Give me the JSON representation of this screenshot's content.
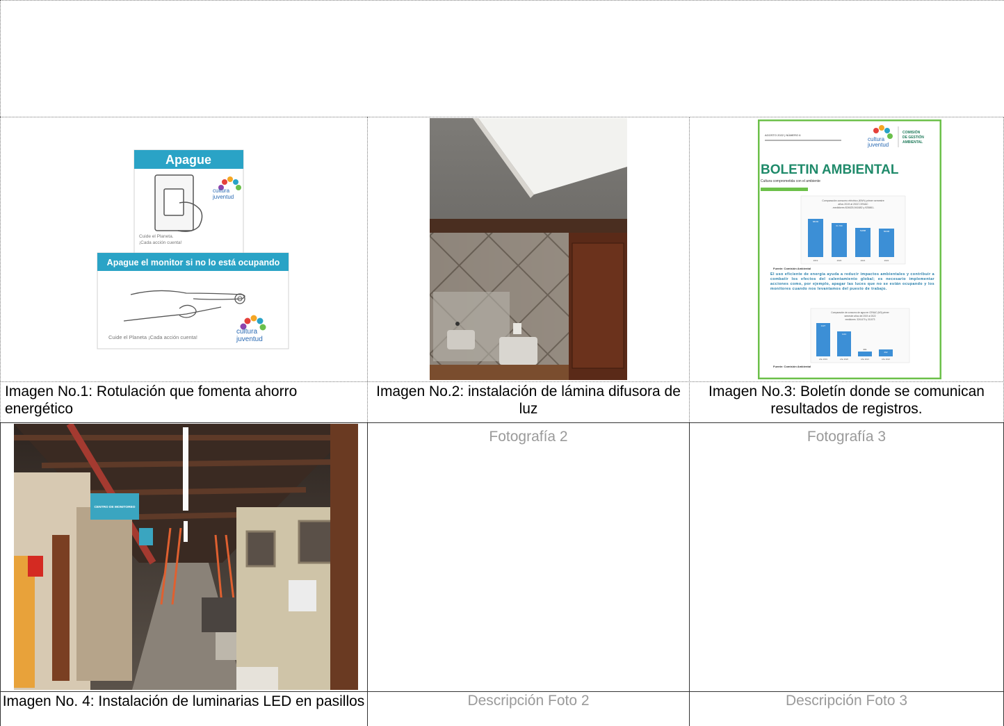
{
  "row1": {
    "image1": {
      "sign_top_title": "Apague",
      "sign_top_footer_1": "Cuide el Planeta.",
      "sign_top_footer_2": "¡Cada acción cuenta!",
      "sign_bottom_title": "Apague el monitor si no lo está ocupando",
      "sign_bottom_footer": "Cuide el Planeta ¡Cada acción cuenta!",
      "logo_text_1": "cultura",
      "logo_text_2": "juventud"
    },
    "image3": {
      "header_small": "AGOSTO 2022 | NÚMERO 6",
      "commission_1": "COMISIÓN",
      "commission_2": "DE GESTIÓN",
      "commission_3": "AMBIENTAL",
      "title": "BOLETIN AMBIENTAL",
      "subtitle": "Cultura comprometida con el ambiente",
      "chart1_title_1": "Comparación consumo eléctrico (KWh) primer semestre",
      "chart1_title_2": "años 2019 al 2022 CENAC",
      "chart1_title_3": "-medidores 824625,941682 y 925861-",
      "chart1_values": [
        "68200",
        "61 700",
        "51888",
        "50098"
      ],
      "chart1_years": [
        "2019",
        "2020",
        "2021",
        "2022"
      ],
      "source_1": "Fuente: Comisión Ambiental",
      "paragraph": "El uso eficiente de energía ayuda a reducir impactos ambientales y contribuir a combatir los efectos del calentamiento global; es necesario implementar acciones como, por ejemplo, apagar las luces que no se están ocupando y los monitores cuando nos levantamos del puesto de trabajo.",
      "chart2_title_1": "Comparación de consumo de agua en CENAC (M3) primer",
      "chart2_title_2": "semestre años del 2019 al 2022",
      "chart2_title_3": "medidores: 3241470 y 311073",
      "chart2_values": [
        "1427",
        "1113",
        "201",
        "292"
      ],
      "chart2_years": [
        "Año 2019",
        "Año 2020",
        "Año 2021",
        "Año 2022"
      ],
      "source_2": "Fuente: Comisión Ambiental"
    },
    "captions": [
      "Imagen No.1: Rotulación que fomenta ahorro energético",
      "Imagen No.2: instalación de lámina difusora de luz",
      "Imagen No.3: Boletín donde se comunican resultados de registros."
    ]
  },
  "row2": {
    "image4": {
      "sign_text": "CENTRO DE MONITOREO"
    },
    "photo_placeholders": [
      "Fotografía 2",
      "Fotografía 3"
    ],
    "captions": [
      "Imagen No. 4: Instalación de luminarias LED en pasillos",
      "Descripción Foto 2",
      "Descripción Foto 3"
    ]
  }
}
